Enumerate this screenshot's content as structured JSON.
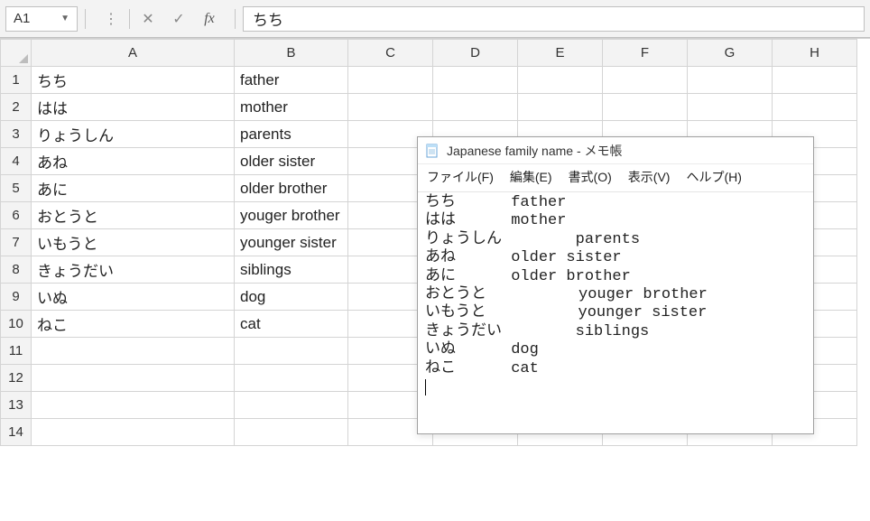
{
  "formula_bar": {
    "name_box": "A1",
    "cancel_icon": "✕",
    "confirm_icon": "✓",
    "fx_label": "fx",
    "dots_icon": "⋮",
    "formula_value": "ちち"
  },
  "columns": [
    "A",
    "B",
    "C",
    "D",
    "E",
    "F",
    "G",
    "H"
  ],
  "row_count": 14,
  "cells": {
    "A1": "ちち",
    "B1": "father",
    "A2": "はは",
    "B2": "mother",
    "A3": "りょうしん",
    "B3": "parents",
    "A4": "あね",
    "B4": "older sister",
    "A5": "あに",
    "B5": "older brother",
    "A6": "おとうと",
    "B6": "youger brother",
    "A7": "いもうと",
    "B7": "younger sister",
    "A8": "きょうだい",
    "B8": "siblings",
    "A9": "いぬ",
    "B9": "dog",
    "A10": "ねこ",
    "B10": "cat"
  },
  "notepad": {
    "title": "Japanese family name - メモ帳",
    "menu": {
      "file": "ファイル(F)",
      "edit": "編集(E)",
      "format": "書式(O)",
      "view": "表示(V)",
      "help": "ヘルプ(H)"
    },
    "lines": [
      "ちち      father",
      "はは      mother",
      "りょうしん        parents",
      "あね      older sister",
      "あに      older brother",
      "おとうと          youger brother",
      "いもうと          younger sister",
      "きょうだい        siblings",
      "いぬ      dog",
      "ねこ      cat"
    ]
  }
}
